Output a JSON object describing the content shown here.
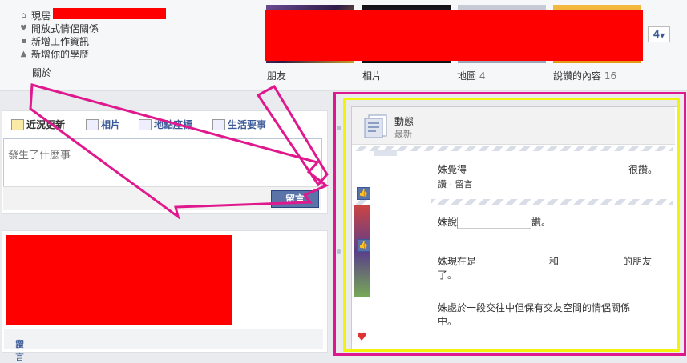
{
  "profile_info": {
    "lives_label": "現居",
    "relationship": "開放式情侶關係",
    "add_work": "新增工作資訊",
    "add_school": "新增你的學歷",
    "about_tab": "關於"
  },
  "section_tabs": {
    "friends": "朋友",
    "photos": "相片",
    "map": "地圖",
    "map_count": "4",
    "likes": "說讚的內容",
    "likes_count": "16",
    "more_count": "4"
  },
  "composer": {
    "tab_status": "近況更新",
    "tab_photo": "相片",
    "tab_place": "地點座標",
    "tab_life_event": "生活要事",
    "placeholder": "發生了什麼事",
    "post_button": "留言"
  },
  "post": {
    "like": "讚",
    "sep": "·",
    "comment": "留言"
  },
  "activity": {
    "title": "動態",
    "subtitle": "最新",
    "items": [
      {
        "lead": "姝覺得",
        "tail": "很讚。",
        "like": "讚",
        "sep": "·",
        "comment": "留言"
      },
      {
        "text": "姝說",
        "tail": "讚。"
      },
      {
        "lead": "姝現在是",
        "mid": "和",
        "tail": "的朋友",
        "line2": "了。"
      },
      {
        "line1": "姝處於一段交往中但保有交友空間的情侶關係",
        "line2": "中。"
      }
    ]
  },
  "colors": {
    "accent": "#3b5998",
    "annotation_pink": "#e0188e",
    "annotation_yellow": "#f2f20a",
    "redaction": "#ff0000"
  }
}
